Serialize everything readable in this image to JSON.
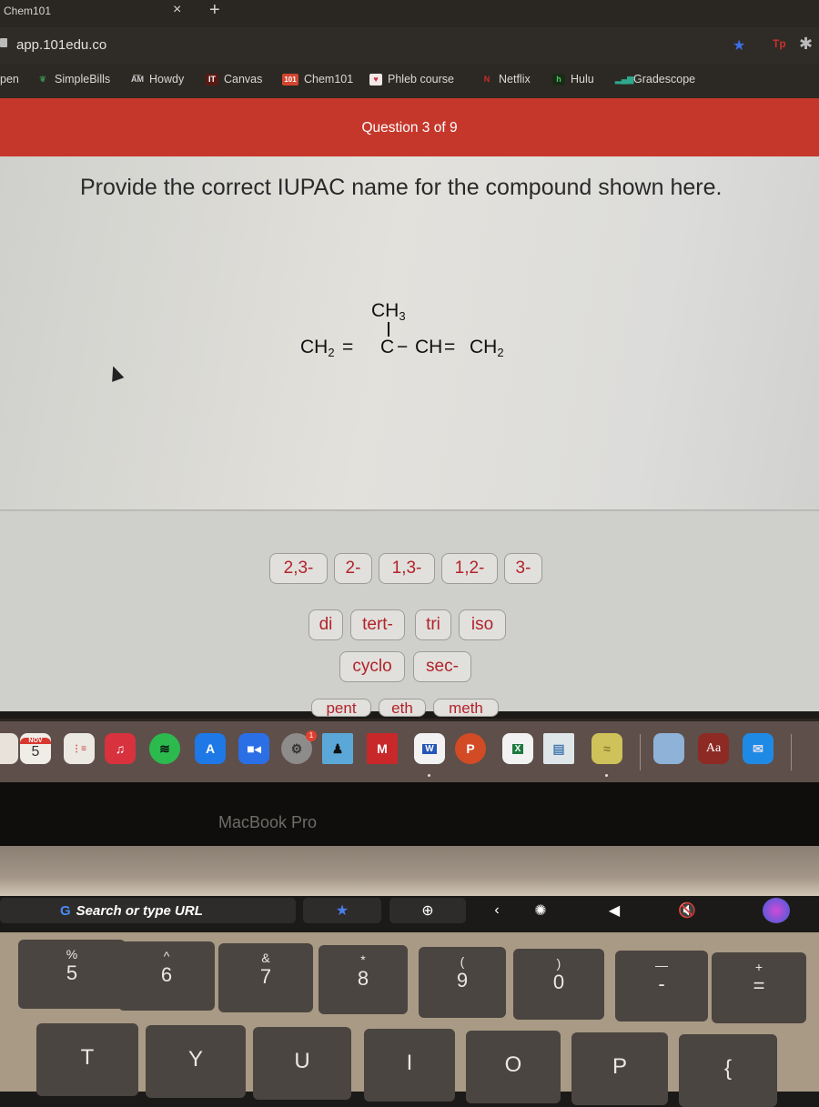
{
  "browser": {
    "tab_title": "Chem101",
    "tab_close": "×",
    "tab_new": "+",
    "url": "app.101edu.co",
    "extensions": {
      "tp": "Tp"
    },
    "bookmarks": [
      {
        "label": "pen",
        "icon": ""
      },
      {
        "label": "SimpleBills",
        "icon": "leaf-icon"
      },
      {
        "label": "Howdy",
        "icon": "atm-icon"
      },
      {
        "label": "Canvas",
        "icon": "it-icon",
        "glyph": "IT"
      },
      {
        "label": "Chem101",
        "icon": "101-icon",
        "glyph": "101"
      },
      {
        "label": "Phleb course",
        "icon": "heart-icon"
      },
      {
        "label": "Netflix",
        "icon": "netflix-icon",
        "glyph": "N"
      },
      {
        "label": "Hulu",
        "icon": "hulu-icon",
        "glyph": "h"
      },
      {
        "label": "Gradescope",
        "icon": "gradescope-icon"
      }
    ]
  },
  "question": {
    "counter": "Question 3 of 9",
    "prompt": "Provide the correct IUPAC name for the compound shown here.",
    "structure": {
      "top_group": "CH",
      "top_sub": "3",
      "left_group": "CH",
      "left_sub": "2",
      "double_bond_1": "=",
      "center": "C",
      "single_bond": "−",
      "mid_group": "CH",
      "double_bond_2": "=",
      "right_group": "CH",
      "right_sub": "2"
    },
    "choices_row1": [
      "2,3-",
      "2-",
      "1,3-",
      "1,2-",
      "3-"
    ],
    "choices_row2": [
      "di",
      "tert-",
      "tri",
      "iso"
    ],
    "choices_row3": [
      "cyclo",
      "sec-"
    ],
    "choices_row4_partial": [
      "pent",
      "eth",
      "meth"
    ]
  },
  "dock": {
    "calendar_month": "NOV",
    "calendar_day": "5",
    "settings_badge": "1",
    "dictionary_label": "Aa",
    "word_letter": "W",
    "powerpoint_letter": "P",
    "excel_letter": "X"
  },
  "laptop": {
    "model_label": "MacBook Pro",
    "touchbar_search": "Search or type URL",
    "touchbar_google": "G",
    "keys_row1": [
      {
        "top": "%",
        "main": "5"
      },
      {
        "top": "^",
        "main": "6"
      },
      {
        "top": "&",
        "main": "7"
      },
      {
        "top": "*",
        "main": "8"
      },
      {
        "top": "(",
        "main": "9"
      },
      {
        "top": ")",
        "main": "0"
      },
      {
        "top": "—",
        "main": "-"
      },
      {
        "top": "+",
        "main": "="
      }
    ],
    "keys_row2": [
      "T",
      "Y",
      "U",
      "I",
      "O",
      "P",
      "{"
    ]
  }
}
